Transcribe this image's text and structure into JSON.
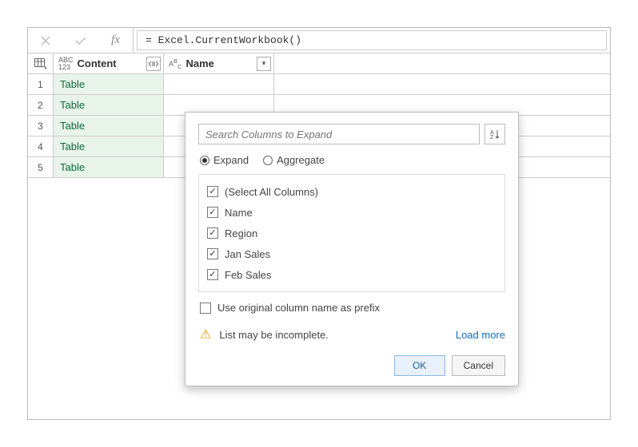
{
  "formula_bar": {
    "formula": "= Excel.CurrentWorkbook()"
  },
  "columns": {
    "content_label": "Content",
    "name_label": "Name"
  },
  "rows": [
    {
      "n": "1",
      "content": "Table"
    },
    {
      "n": "2",
      "content": "Table"
    },
    {
      "n": "3",
      "content": "Table"
    },
    {
      "n": "4",
      "content": "Table"
    },
    {
      "n": "5",
      "content": "Table"
    }
  ],
  "popup": {
    "search_placeholder": "Search Columns to Expand",
    "mode_expand": "Expand",
    "mode_aggregate": "Aggregate",
    "columns": [
      "(Select All Columns)",
      "Name",
      "Region",
      "Jan Sales",
      "Feb Sales"
    ],
    "prefix_label": "Use original column name as prefix",
    "warning": "List may be incomplete.",
    "load_more": "Load more",
    "ok": "OK",
    "cancel": "Cancel"
  }
}
